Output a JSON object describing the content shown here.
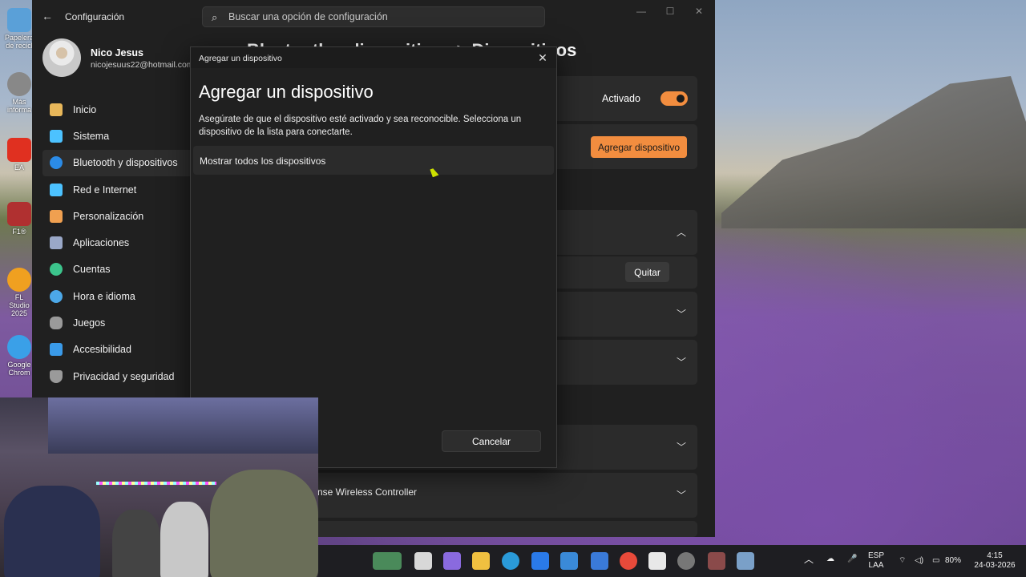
{
  "settings": {
    "app_title": "Configuración",
    "search_placeholder": "Buscar una opción de configuración",
    "profile": {
      "name": "Nico Jesus",
      "email": "nicojesuus22@hotmail.com"
    },
    "nav": [
      {
        "label": "Inicio",
        "icon": "home-icon",
        "color": "#e8b75a"
      },
      {
        "label": "Sistema",
        "icon": "monitor-icon",
        "color": "#4cc2ff"
      },
      {
        "label": "Bluetooth y dispositivos",
        "icon": "bluetooth-icon",
        "color": "#2b8be6"
      },
      {
        "label": "Red e Internet",
        "icon": "wifi-icon",
        "color": "#4cc2ff"
      },
      {
        "label": "Personalización",
        "icon": "brush-icon",
        "color": "#f0a050"
      },
      {
        "label": "Aplicaciones",
        "icon": "apps-icon",
        "color": "#9aa8c8"
      },
      {
        "label": "Cuentas",
        "icon": "person-icon",
        "color": "#3cc48c"
      },
      {
        "label": "Hora e idioma",
        "icon": "clock-globe-icon",
        "color": "#4ca8e8"
      },
      {
        "label": "Juegos",
        "icon": "gamepad-icon",
        "color": "#9a9a9a"
      },
      {
        "label": "Accesibilidad",
        "icon": "accessibility-icon",
        "color": "#3a9ae8"
      },
      {
        "label": "Privacidad y seguridad",
        "icon": "shield-icon",
        "color": "#9a9a9a"
      }
    ],
    "page_heading": "Bluetooth y dispositivos > Dispositivos",
    "bluetooth_toggle_label": "Activado",
    "add_device_label": "Agregar dispositivo",
    "remove_label": "Quitar",
    "controller_name_partial": "nse Wireless Controller"
  },
  "dialog": {
    "titlebar": "Agregar un dispositivo",
    "heading": "Agregar un dispositivo",
    "description": "Asegúrate de que el dispositivo esté activado y sea reconocible. Selecciona un dispositivo de la lista para conectarte.",
    "show_all": "Mostrar todos los dispositivos",
    "cancel": "Cancelar"
  },
  "desktop_icons": [
    {
      "label": "Papelera de recicl",
      "color": "#5aa0d8"
    },
    {
      "label": "Más informa",
      "color": "#888"
    },
    {
      "label": "EA",
      "color": "#e03020"
    },
    {
      "label": "F1®",
      "color": "#b03030"
    },
    {
      "label": "FL Studio 2025",
      "color": "#f0a020"
    },
    {
      "label": "Google Chrom",
      "color": "#3aa0e8"
    }
  ],
  "taskbar": {
    "language": "ESP",
    "layout": "LAA",
    "battery": "80%",
    "time": "4:15",
    "date": "24-03-2026"
  },
  "colors": {
    "accent": "#f28d3f",
    "window_bg": "#202020",
    "card_bg": "#2b2b2b"
  }
}
